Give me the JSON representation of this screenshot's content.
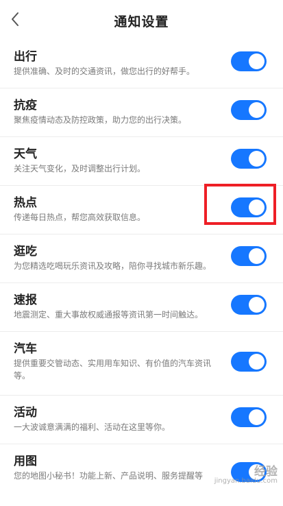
{
  "header": {
    "title": "通知设置",
    "back_icon": "chevron-left-icon"
  },
  "settings": [
    {
      "title": "出行",
      "desc": "提供准确、及时的交通资讯，做您出行的好帮手。",
      "on": true
    },
    {
      "title": "抗疫",
      "desc": "聚焦疫情动态及防控政策，助力您的出行决策。",
      "on": true
    },
    {
      "title": "天气",
      "desc": "关注天气变化，及时调整出行计划。",
      "on": true
    },
    {
      "title": "热点",
      "desc": "传递每日热点，帮您高效获取信息。",
      "on": true
    },
    {
      "title": "逛吃",
      "desc": "为您精选吃喝玩乐资讯及攻略，陪你寻找城市新乐趣。",
      "on": true
    },
    {
      "title": "速报",
      "desc": "地震测定、重大事故权威通报等资讯第一时间触达。",
      "on": true
    },
    {
      "title": "汽车",
      "desc": "提供重要交管动态、实用用车知识、有价值的汽车资讯等。",
      "on": true
    },
    {
      "title": "活动",
      "desc": "一大波诚意满满的福利、活动在这里等你。",
      "on": true
    },
    {
      "title": "用图",
      "desc": "您的地图小秘书！功能上新、产品说明、服务提醒等",
      "on": true
    }
  ],
  "colors": {
    "accent": "#1677ff",
    "highlight": "#ee1f26"
  },
  "watermark": {
    "line1": "经验",
    "line2": "jingyan.baidu.com"
  }
}
